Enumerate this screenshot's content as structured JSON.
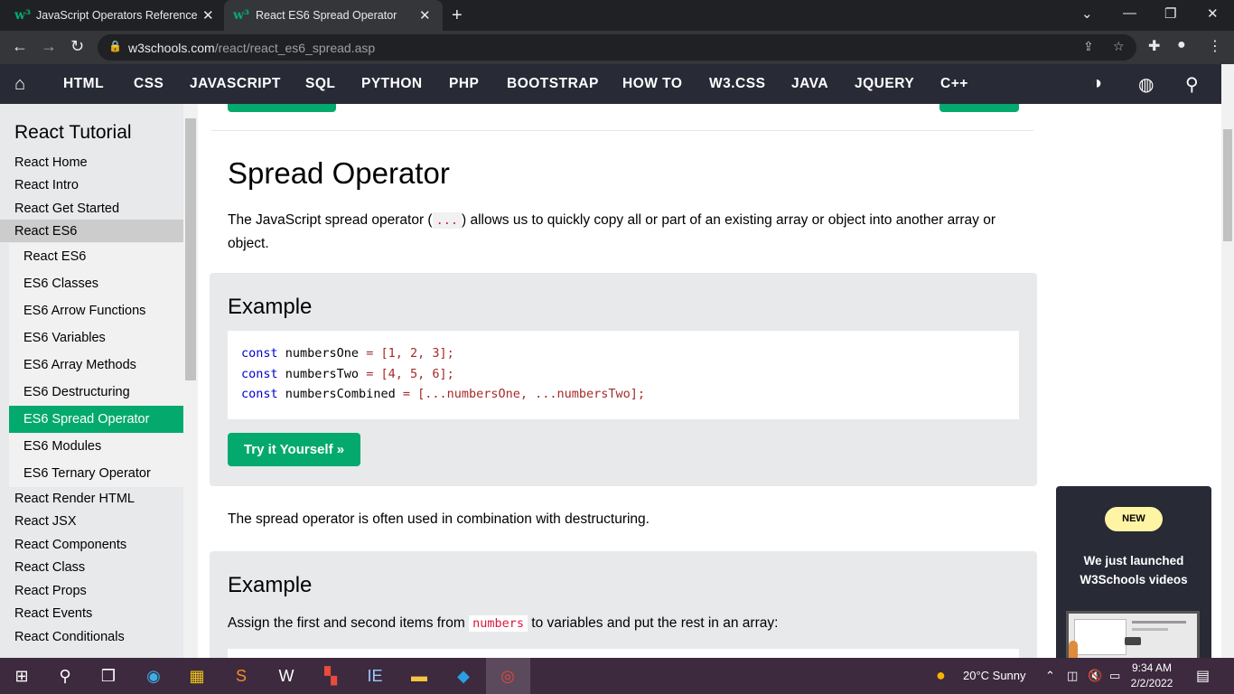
{
  "browser": {
    "tabs": [
      {
        "title": "JavaScript Operators Reference",
        "favicon": "w3schools-logo"
      },
      {
        "title": "React ES6 Spread Operator",
        "favicon": "w3schools-logo"
      }
    ],
    "url_domain": "w3schools.com",
    "url_path": "/react/react_es6_spread.asp"
  },
  "topnav": {
    "items": [
      "HTML",
      "CSS",
      "JAVASCRIPT",
      "SQL",
      "PYTHON",
      "PHP",
      "BOOTSTRAP",
      "HOW TO",
      "W3.CSS",
      "JAVA",
      "JQUERY",
      "C++"
    ]
  },
  "sidebar": {
    "title": "React Tutorial",
    "top_links": [
      "React Home",
      "React Intro",
      "React Get Started"
    ],
    "active_section": "React ES6",
    "sub_links": [
      "React ES6",
      "ES6 Classes",
      "ES6 Arrow Functions",
      "ES6 Variables",
      "ES6 Array Methods",
      "ES6 Destructuring",
      "ES6 Spread Operator",
      "ES6 Modules",
      "ES6 Ternary Operator"
    ],
    "active_sub": "ES6 Spread Operator",
    "bottom_links": [
      "React Render HTML",
      "React JSX",
      "React Components",
      "React Class",
      "React Props",
      "React Events",
      "React Conditionals"
    ]
  },
  "main": {
    "title": "Spread Operator",
    "intro_before": "The JavaScript spread operator (",
    "intro_code": "...",
    "intro_after": ") allows us to quickly copy all or part of an existing array or object into another array or object.",
    "example1": {
      "heading": "Example",
      "code": [
        {
          "kw": "const",
          "name": "numbersOne",
          "eq": " = ",
          "body": "[1, 2, 3];"
        },
        {
          "kw": "const",
          "name": "numbersTwo",
          "eq": " = ",
          "body": "[4, 5, 6];"
        },
        {
          "kw": "const",
          "name": "numbersCombined",
          "eq": " = ",
          "body": "[...numbersOne, ...numbersTwo];"
        }
      ],
      "button": "Try it Yourself »"
    },
    "para2": "The spread operator is often used in combination with destructuring.",
    "example2": {
      "heading": "Example",
      "desc_before": "Assign the first and second items from ",
      "desc_code": "numbers",
      "desc_after": " to variables and put the rest in an array:"
    }
  },
  "promo": {
    "badge": "NEW",
    "line1": "We just launched",
    "line2": "W3Schools videos"
  },
  "taskbar": {
    "weather": "20°C  Sunny",
    "time": "9:34 AM",
    "date": "2/2/2022"
  },
  "colors": {
    "brand_green": "#04aa6d",
    "nav_dark": "#282a35",
    "sidebar_bg": "#e7e9eb"
  }
}
